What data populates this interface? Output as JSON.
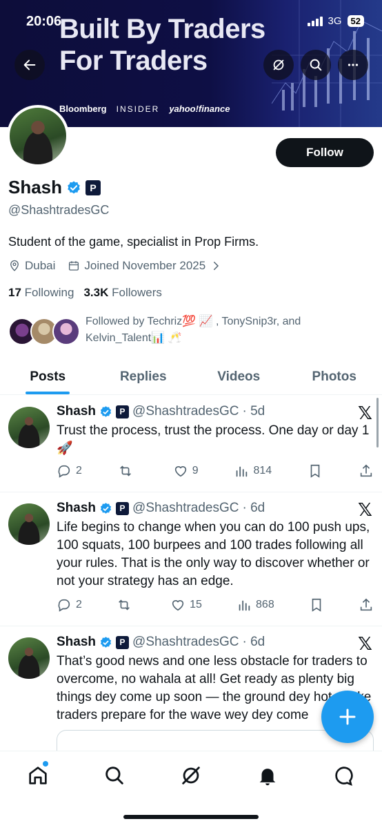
{
  "status_bar": {
    "time": "20:06",
    "network": "3G",
    "battery": "52"
  },
  "banner": {
    "line1": "Built By Traders",
    "line2": "For Traders",
    "logos": [
      "Bloomberg",
      "INSIDER",
      "yahoo!finance"
    ]
  },
  "header": {
    "back_icon": "back-arrow-icon",
    "grok_icon": "grok-icon",
    "search_icon": "search-icon",
    "more_icon": "more-icon"
  },
  "profile": {
    "follow_label": "Follow",
    "name": "Shash",
    "handle": "@ShashtradesGC",
    "bio": "Student of the game, specialist in Prop Firms.",
    "location": "Dubai",
    "joined": "Joined November 2025",
    "following_count": "17",
    "following_label": "Following",
    "followers_count": "3.3K",
    "followers_label": "Followers",
    "followed_by": "Followed by Techriz💯 📈 , TonySnip3r, and Kelvin_Talent📊 🥂"
  },
  "tabs": [
    "Posts",
    "Replies",
    "Videos",
    "Photos"
  ],
  "posts": [
    {
      "name": "Shash",
      "handle": "@ShashtradesGC",
      "time": "· 5d",
      "text": "Trust the process, trust the process. One day or day 1 🚀",
      "replies": "2",
      "retweets": "",
      "likes": "9",
      "views": "814"
    },
    {
      "name": "Shash",
      "handle": "@ShashtradesGC",
      "time": "· 6d",
      "text": "Life begins to change when you can do 100 push ups, 100 squats, 100 burpees and 100 trades following all your rules. That is the only way to discover whether or not your strategy has an edge.",
      "replies": "2",
      "retweets": "",
      "likes": "15",
      "views": "868"
    },
    {
      "name": "Shash",
      "handle": "@ShashtradesGC",
      "time": "· 6d",
      "text": "That’s good news and one less obstacle for traders to overcome, no wahala at all! Get ready as plenty big things dey come up soon — the ground dey hot, make traders prepare for the wave wey dey come",
      "replies": "",
      "retweets": "",
      "likes": "",
      "views": ""
    }
  ],
  "colors": {
    "accent": "#1d9bf0",
    "text": "#0f1419",
    "muted": "#536471",
    "banner": "#0e0f45"
  }
}
